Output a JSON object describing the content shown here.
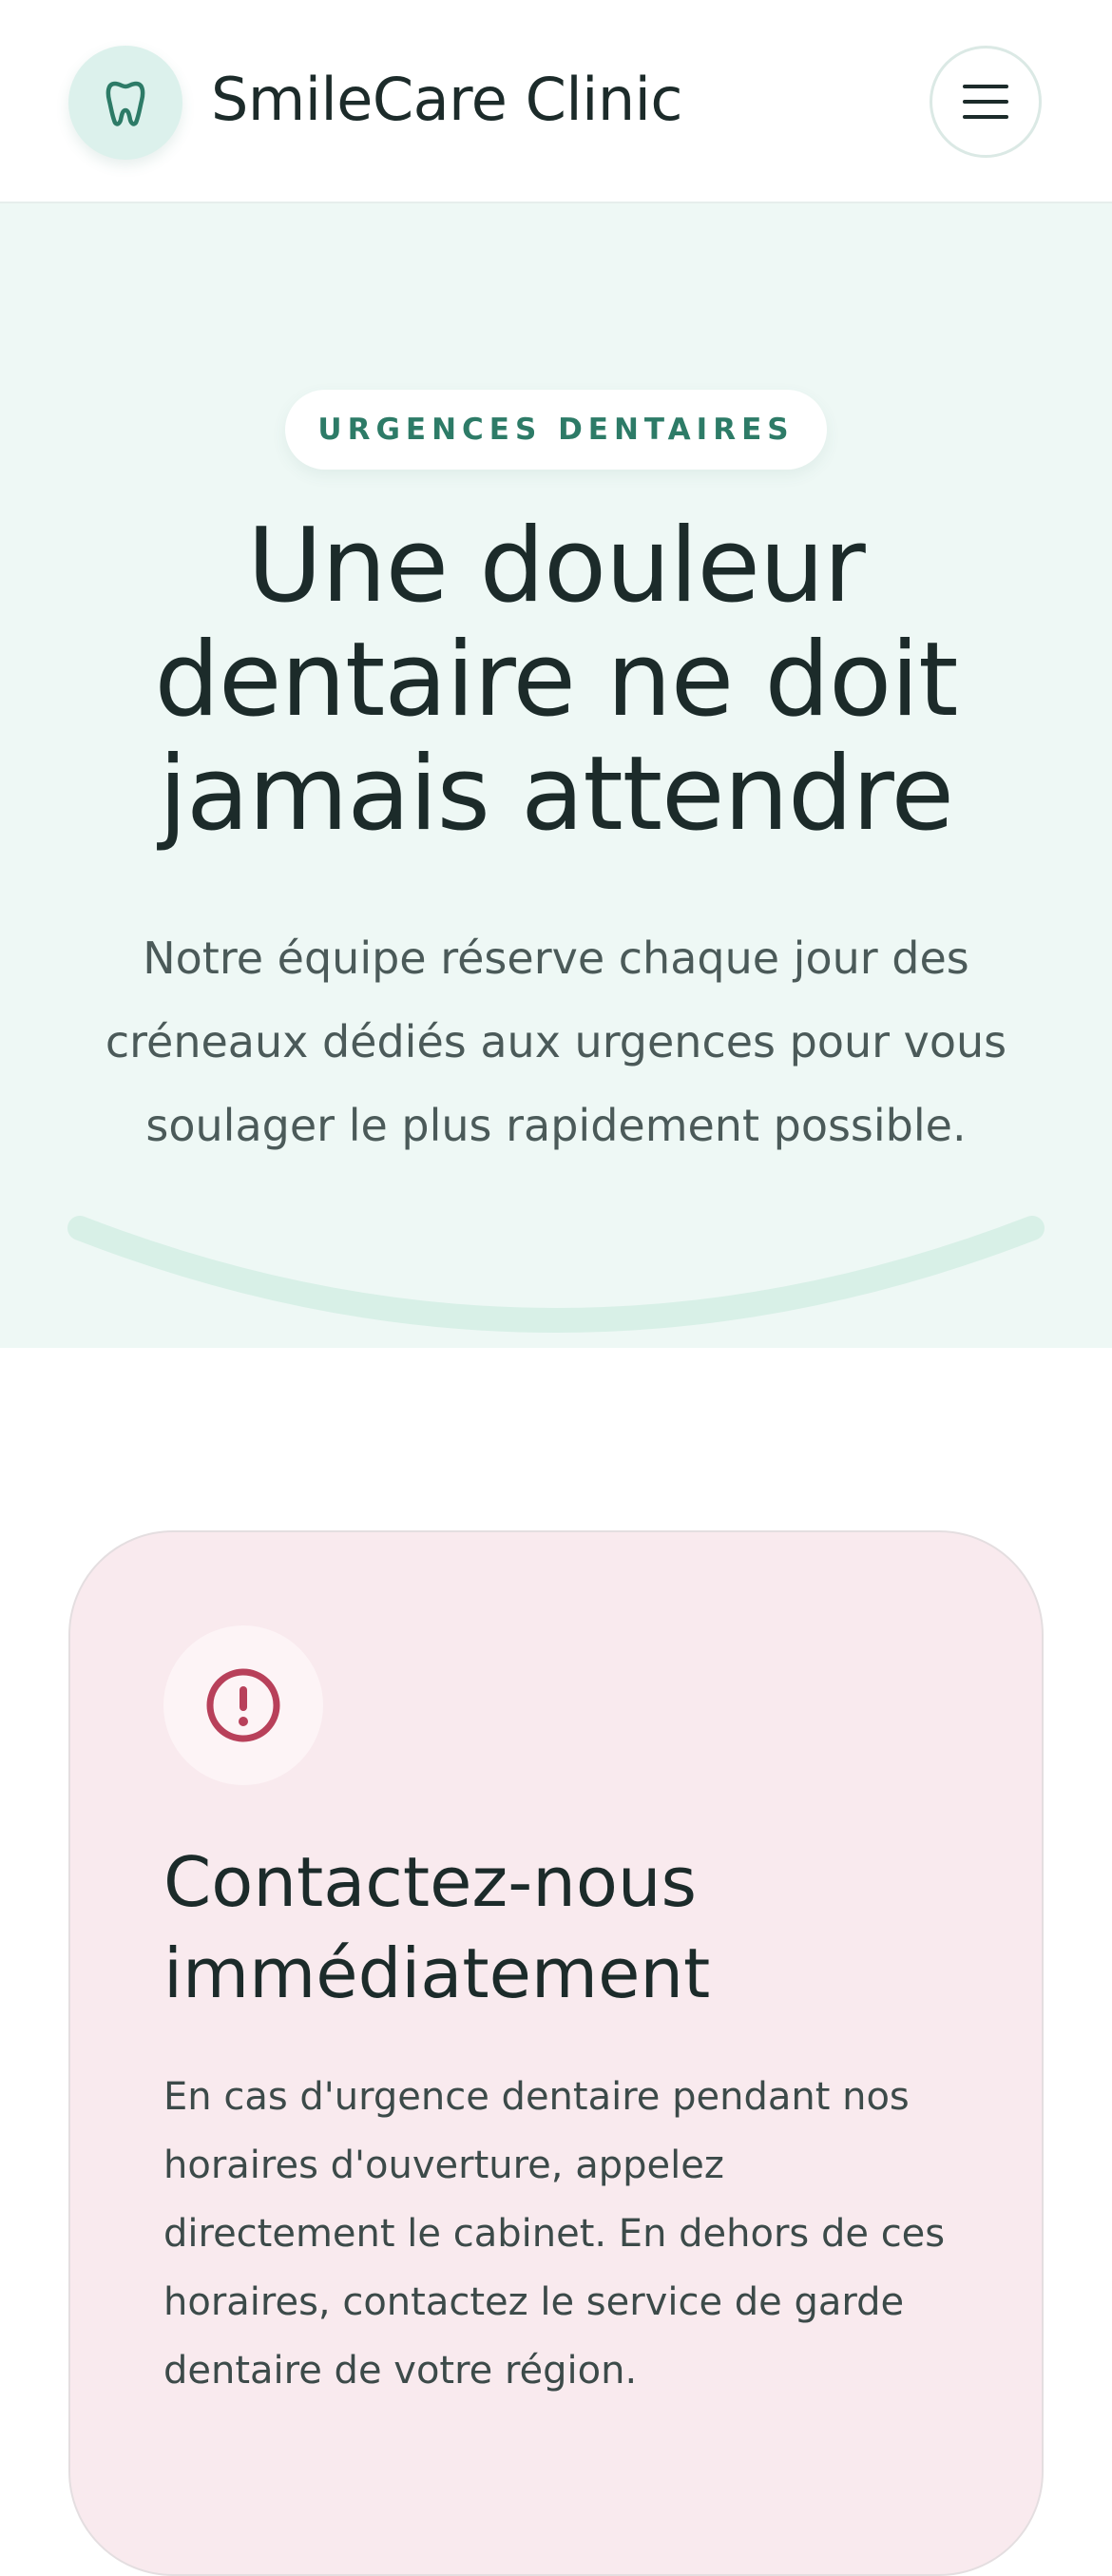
{
  "header": {
    "brand": "SmileCare Clinic",
    "logo_icon": "tooth-icon",
    "menu_icon": "hamburger-menu-icon"
  },
  "hero": {
    "eyebrow": "URGENCES DENTAIRES",
    "title": "Une douleur dentaire ne doit jamais attendre",
    "subtitle": "Notre équipe réserve chaque jour des créneaux dédiés aux urgences pour vous soulager le plus rapidement possible."
  },
  "emergency_card": {
    "icon": "alert-circle-icon",
    "title": "Contactez-nous immédiatement",
    "text": "En cas d'urgence dentaire pendant nos horaires d'ouverture, appelez directement le cabinet. En dehors de ces horaires, contactez le service de garde dentaire de votre région."
  },
  "colors": {
    "accent": "#2d7b67",
    "hero_background": "#eef8f5",
    "alert": "#b8405a",
    "card_background": "#f9eaee"
  }
}
